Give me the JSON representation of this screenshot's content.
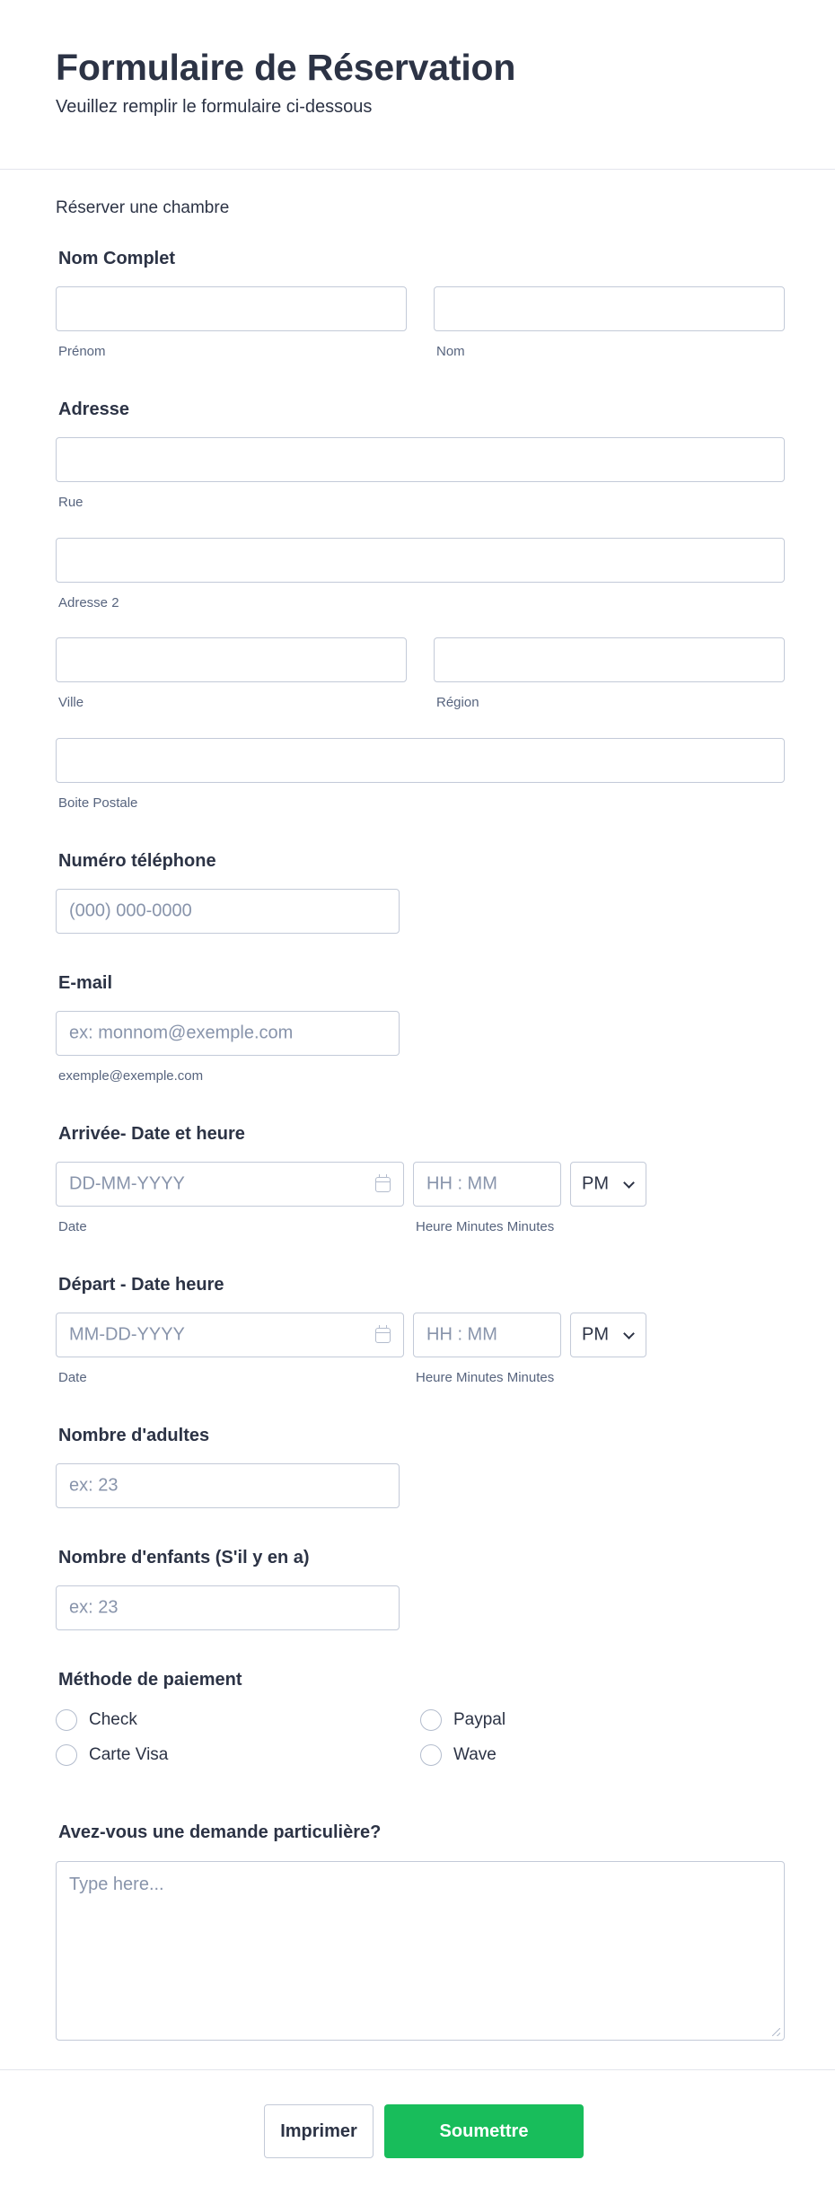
{
  "header": {
    "title": "Formulaire de Réservation",
    "subtitle": "Veuillez remplir le formulaire ci-dessous"
  },
  "intro": "Réserver une chambre",
  "full_name": {
    "label": "Nom Complet",
    "first_sublabel": "Prénom",
    "last_sublabel": "Nom"
  },
  "address": {
    "label": "Adresse",
    "street_sublabel": "Rue",
    "street2_sublabel": "Adresse 2",
    "city_sublabel": "Ville",
    "region_sublabel": "Région",
    "postal_sublabel": "Boite Postale"
  },
  "phone": {
    "label": "Numéro téléphone",
    "placeholder": "(000) 000-0000"
  },
  "email": {
    "label": "E-mail",
    "placeholder": "ex: monnom@exemple.com",
    "sublabel": "exemple@exemple.com"
  },
  "arrival": {
    "label": "Arrivée- Date et heure",
    "date_placeholder": "DD-MM-YYYY",
    "time_placeholder": "HH : MM",
    "ampm": "PM",
    "date_sublabel": "Date",
    "time_sublabel": "Heure Minutes Minutes"
  },
  "departure": {
    "label": "Départ - Date heure",
    "date_placeholder": "MM-DD-YYYY",
    "time_placeholder": "HH : MM",
    "ampm": "PM",
    "date_sublabel": "Date",
    "time_sublabel": "Heure Minutes Minutes"
  },
  "adults": {
    "label": "Nombre d'adultes",
    "placeholder": "ex: 23"
  },
  "children": {
    "label": "Nombre d'enfants (S'il y en a)",
    "placeholder": "ex: 23"
  },
  "payment": {
    "label": "Méthode de paiement",
    "options": [
      "Check",
      "Paypal",
      "Carte Visa",
      "Wave"
    ]
  },
  "request": {
    "label": "Avez-vous une demande particulière?",
    "placeholder": "Type here..."
  },
  "footer": {
    "print_label": "Imprimer",
    "submit_label": "Soumettre",
    "submit_color": "#18bd5b"
  }
}
